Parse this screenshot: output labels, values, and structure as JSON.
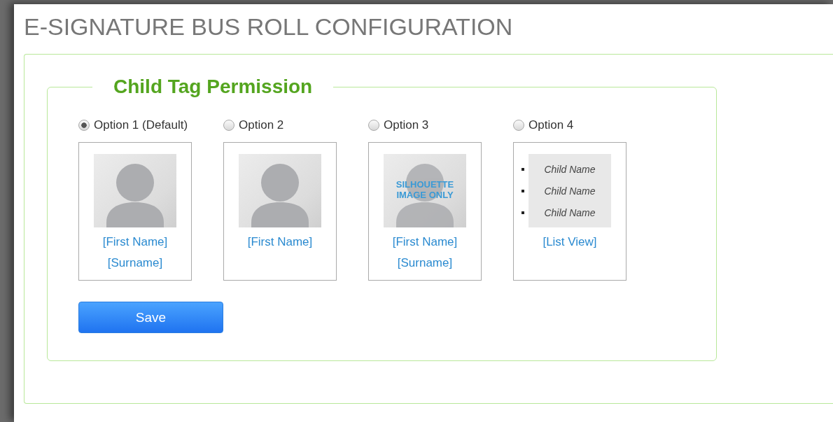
{
  "page": {
    "title": "E-SIGNATURE BUS ROLL CONFIGURATION"
  },
  "section": {
    "legend": "Child Tag Permission",
    "options": [
      {
        "label": "Option 1 (Default)",
        "selected": true,
        "kind": "photo",
        "lines": [
          "[First Name]",
          "[Surname]"
        ]
      },
      {
        "label": "Option 2",
        "selected": false,
        "kind": "photo",
        "lines": [
          "[First Name]"
        ]
      },
      {
        "label": "Option 3",
        "selected": false,
        "kind": "silhouette",
        "overlay": [
          "SILHOUETTE",
          "IMAGE ONLY"
        ],
        "lines": [
          "[First Name]",
          "[Surname]"
        ]
      },
      {
        "label": "Option 4",
        "selected": false,
        "kind": "list",
        "items": [
          "Child Name",
          "Child Name",
          "Child Name"
        ],
        "lines": [
          "[List View]"
        ]
      }
    ],
    "save_button": "Save"
  }
}
